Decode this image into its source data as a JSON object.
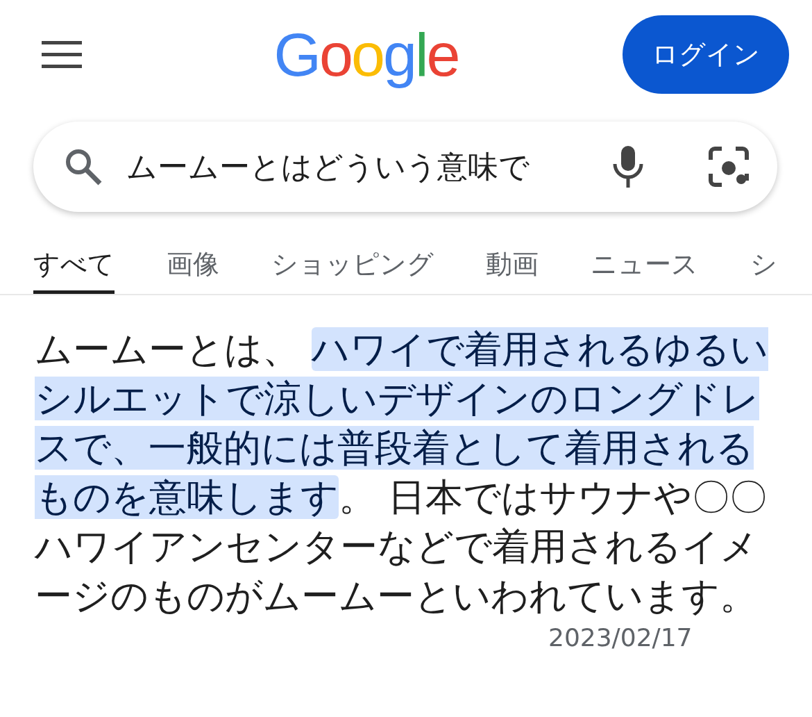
{
  "header": {
    "logo": "Google",
    "login_button": "ログイン"
  },
  "search": {
    "value": "ムームーとはどういう意味で"
  },
  "tabs": [
    {
      "label": "すべて",
      "selected": true
    },
    {
      "label": "画像",
      "selected": false
    },
    {
      "label": "ショッピング",
      "selected": false
    },
    {
      "label": "動画",
      "selected": false
    },
    {
      "label": "ニュース",
      "selected": false
    },
    {
      "label": "シ",
      "selected": false
    }
  ],
  "answer": {
    "before": "ムームーとは、 ",
    "highlight": "ハワイで着用されるゆるいシルエットで涼しいデザインのロングドレスで、一般的には普段着として着用されるものを意味します",
    "after": "。 日本ではサウナや〇〇ハワイアンセンターなどで着用されるイメージのものがムームーといわれています。",
    "date": "2023/02/17"
  }
}
